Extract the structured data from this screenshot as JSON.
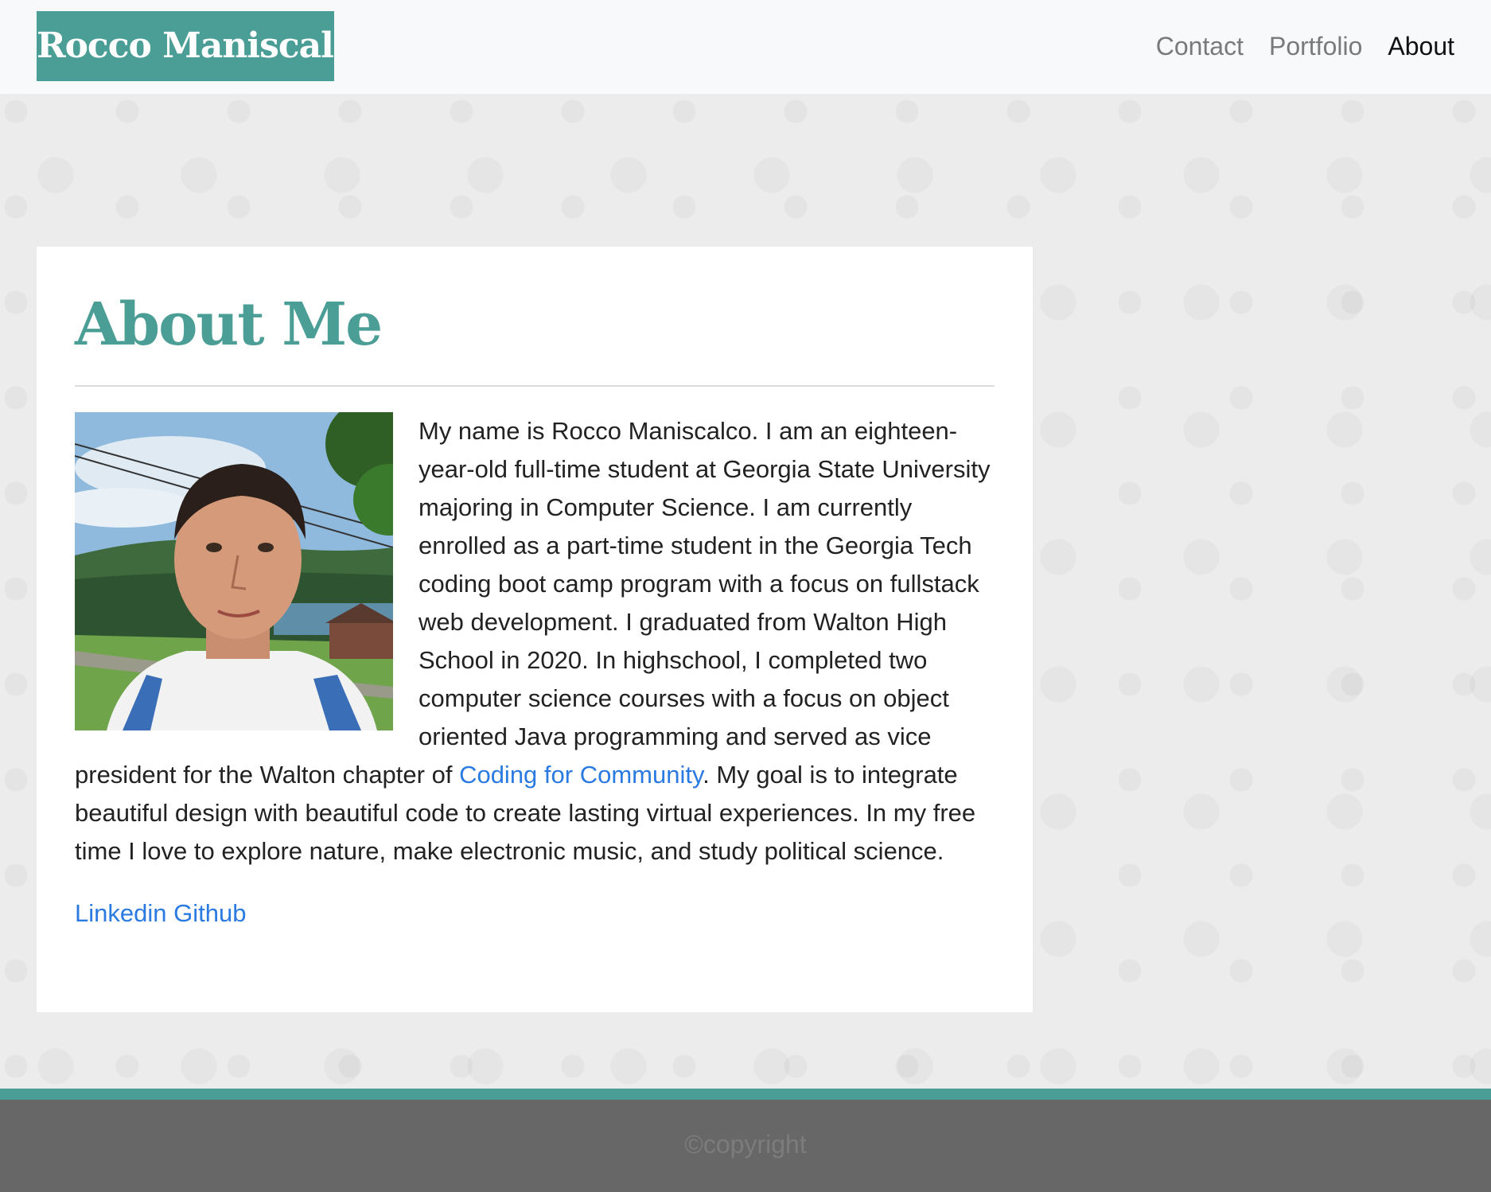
{
  "navbar": {
    "brand": "Rocco Maniscalco",
    "links": [
      {
        "label": "Contact"
      },
      {
        "label": "Portfolio"
      },
      {
        "label": "About"
      }
    ],
    "active": "About"
  },
  "card": {
    "title": "About Me",
    "bio_part1": "My name is Rocco Maniscalco. I am an eighteen-year-old full-time student at Georgia State University majoring in Computer Science. I am currently enrolled as a part-time student in the Georgia Tech coding boot camp program with a focus on fullstack web development. I graduated from Walton High School in 2020. In highschool, I completed two computer science courses with a focus on object oriented Java programming and served as vice president for the Walton chapter of ",
    "bio_link": "Coding for Community",
    "bio_part2": ". My goal is to integrate beautiful design with beautiful code to create lasting virtual experiences. In my free time I love to explore nature, make electronic music, and study political science.",
    "social_links": [
      {
        "label": "Linkedin"
      },
      {
        "label": "Github"
      }
    ]
  },
  "footer": {
    "text": "©copyright"
  },
  "colors": {
    "accent": "#4b9e96",
    "link": "#2a7ae2",
    "footer_bg": "#676767"
  }
}
